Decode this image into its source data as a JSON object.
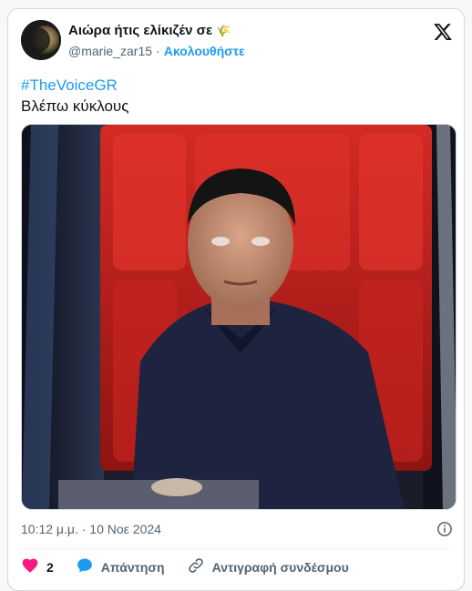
{
  "header": {
    "display_name": "Αιώρα ήτις ελίκιζέν σε",
    "display_name_emoji": "🌾",
    "handle": "@marie_zar15",
    "separator": "·",
    "follow_label": "Ακολουθήστε",
    "logo_icon": "x-logo-icon"
  },
  "tweet": {
    "hashtag": "#TheVoiceGR",
    "text": "Βλέπω κύκλους"
  },
  "meta": {
    "time": "10:12 μ.μ.",
    "separator": "·",
    "date": "10 Νοε 2024"
  },
  "actions": {
    "like_count": "2",
    "reply_label": "Απάντηση",
    "copy_link_label": "Αντιγραφή συνδέσμου"
  },
  "colors": {
    "accent": "#1d9bf0",
    "like": "#f91880",
    "muted": "#536471",
    "text": "#0f1419"
  }
}
